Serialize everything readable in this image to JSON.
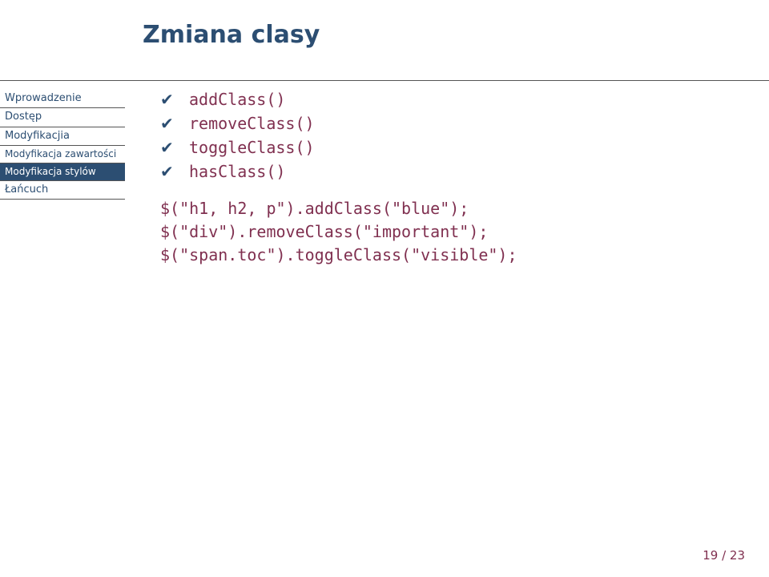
{
  "title": "Zmiana clasy",
  "sidebar": {
    "items": [
      {
        "label": "Wprowadzenie",
        "sub": false,
        "selected": false
      },
      {
        "label": "Dostęp",
        "sub": false,
        "selected": false
      },
      {
        "label": "Modyfikacjia",
        "sub": false,
        "selected": false
      },
      {
        "label": "Modyfikacja zawartości",
        "sub": true,
        "selected": false
      },
      {
        "label": "Modyfikacja stylów",
        "sub": true,
        "selected": true
      },
      {
        "label": "Łańcuch",
        "sub": false,
        "selected": false
      }
    ]
  },
  "bullets": [
    "addClass()",
    "removeClass()",
    "toggleClass()",
    "hasClass()"
  ],
  "codelines": [
    "$(\"h1, h2, p\").addClass(\"blue\");",
    "$(\"div\").removeClass(\"important\");",
    "$(\"span.toc\").toggleClass(\"visible\");"
  ],
  "pager": "19 / 23"
}
